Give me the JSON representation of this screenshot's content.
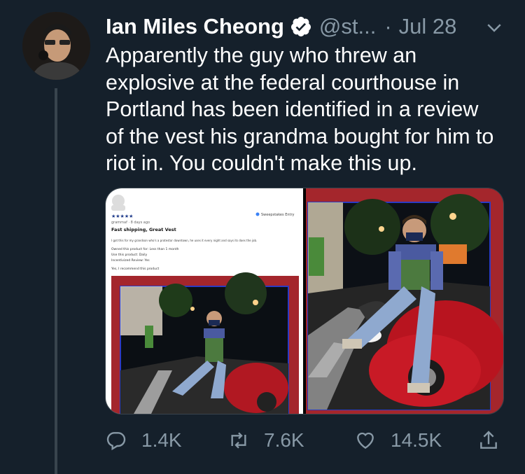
{
  "tweet": {
    "author_name": "Ian Miles Cheong",
    "handle": "@st...",
    "separator": "·",
    "date": "Jul 28",
    "text": "Apparently the guy who threw an\nexplosive at the federal courthouse in\nPortland has been identified in a review\nof the vest his grandma bought for him to\nriot in. You couldn't make this up."
  },
  "review": {
    "stars": "★★★★★",
    "user": "grammaf · 8 days ago",
    "badge": "Sweepstakes Entry",
    "title": "Fast shipping, Great Vest",
    "body": "I got this for my grandson who's a protestor downtown, he uses it every night and says its does the job.",
    "owned": "Owned this product for: Less than 1 month",
    "use": "Use this product: Daily",
    "incentivized": "Incentivized Review: Yes",
    "recommend": "Yes, I recommend this product"
  },
  "actions": {
    "reply_count": "1.4K",
    "retweet_count": "7.6K",
    "like_count": "14.5K"
  },
  "colors": {
    "background": "#15202b",
    "text": "#ffffff",
    "secondary": "#8899a6",
    "verified": "#ffffff",
    "photo_frame": "#a4262c"
  },
  "icons": [
    "verified-badge-icon",
    "chevron-down-icon",
    "reply-icon",
    "retweet-icon",
    "like-icon",
    "share-icon"
  ]
}
